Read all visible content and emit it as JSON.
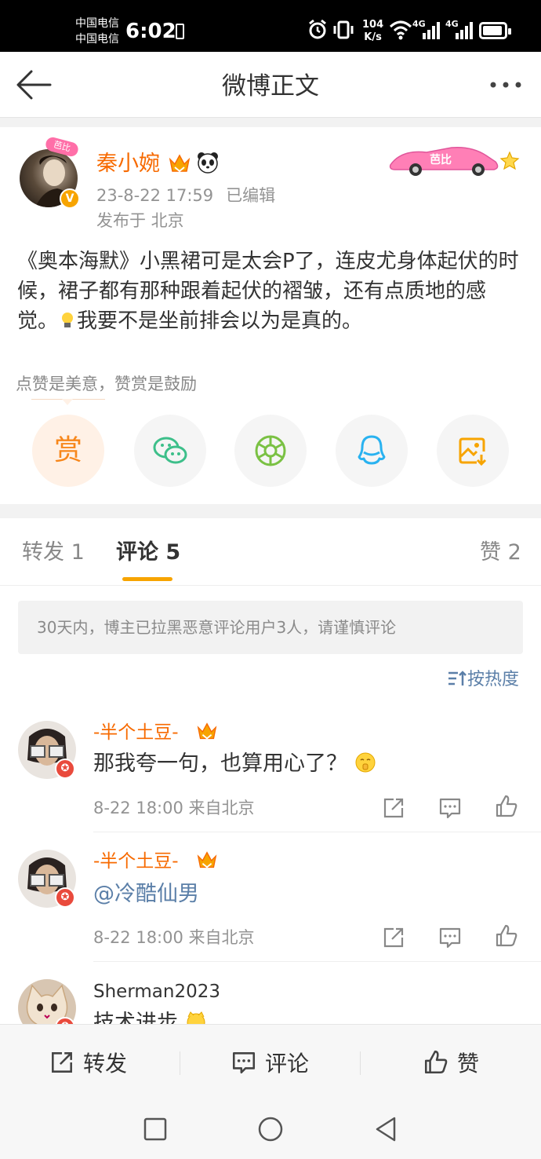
{
  "status_bar": {
    "carrier1": "中国电信",
    "carrier2": "中国电信",
    "time": "6:02",
    "speed_value": "104",
    "speed_unit": "K/s",
    "net1": "4G",
    "net2": "4G"
  },
  "nav": {
    "title": "微博正文"
  },
  "post": {
    "author": "秦小婉",
    "avatar_badge": "V",
    "time": "23-8-22 17:59",
    "edited": "已编辑",
    "location": "发布于 北京",
    "content": "《奥本海默》小黑裙可是太会P了，连皮尤身体起伏的时候，裙子都有那种跟着起伏的褶皱，还有点质地的感觉。",
    "content_tail": "我要不是坐前排会以为是真的。",
    "decoration_text": "芭比"
  },
  "reward_hint": "点赞是美意，赞赏是鼓励",
  "share_buttons": [
    {
      "name": "reward",
      "label": "赏"
    },
    {
      "name": "wechat"
    },
    {
      "name": "moments"
    },
    {
      "name": "qq"
    },
    {
      "name": "save-image"
    }
  ],
  "tabs": {
    "repost": "转发 1",
    "comment": "评论 5",
    "like": "赞 2"
  },
  "notice": "30天内，博主已拉黑恶意评论用户3人，请谨慎评论",
  "sort_label": "按热度",
  "comments": [
    {
      "user": "-半个土豆-",
      "text": "那我夸一句，也算用心了？",
      "meta": "8-22 18:00 来自北京"
    },
    {
      "user": "-半个土豆-",
      "text": "@冷酷仙男",
      "meta": "8-22 18:00 来自北京"
    },
    {
      "user": "Sherman2023",
      "text": "技术进步"
    }
  ],
  "bottom_bar": {
    "repost": "转发",
    "comment": "评论",
    "like": "赞"
  }
}
